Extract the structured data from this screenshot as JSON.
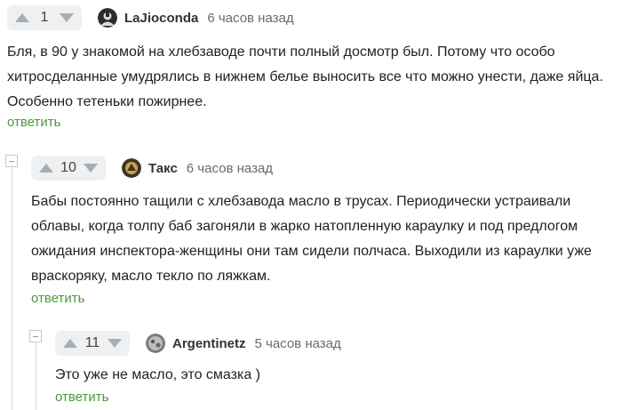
{
  "comments": [
    {
      "rating": "1",
      "author": "LaJioconda",
      "time": "6 часов назад",
      "text": "Бля, в 90 у знакомой на хлебзаводе почти полный досмотр был. Потому что особо хитросделанные умудрялись в нижнем белье выносить все что можно унести, даже яйца. Особенно тетеньки пожирнее.",
      "reply": "ответить"
    },
    {
      "rating": "10",
      "author": "Такс",
      "time": "6 часов назад",
      "text": "Бабы постоянно тащили с хлебзавода масло в трусах. Периодически устраивали облавы, когда толпу баб загоняли в жарко натопленную караулку и под предлогом ожидания инспектора-женщины они там сидели полчаса. Выходили из караулки уже враскоряку, масло текло по ляжкам.",
      "reply": "ответить"
    },
    {
      "rating": "11",
      "author": "Argentinetz",
      "time": "5 часов назад",
      "text": "Это уже не масло, это смазка )",
      "reply": "ответить"
    }
  ]
}
